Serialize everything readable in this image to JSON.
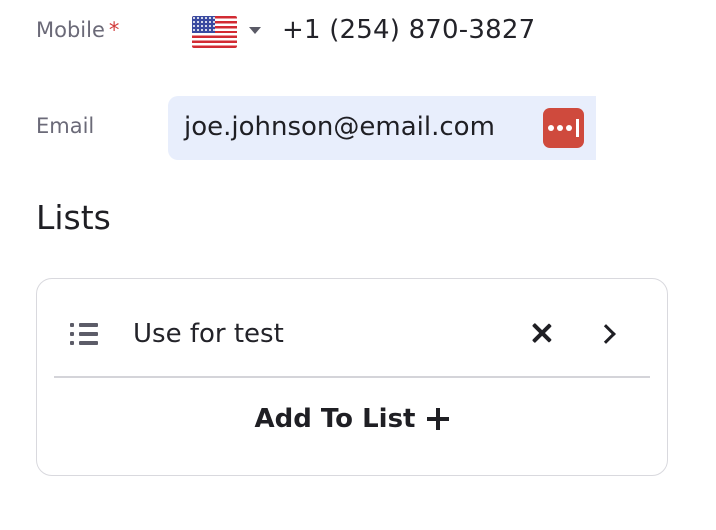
{
  "mobile": {
    "label": "Mobile",
    "required_mark": "*",
    "country_flag": "us-flag-icon",
    "value": "+1 (254) 870-3827"
  },
  "email": {
    "label": "Email",
    "value": "joe.johnson@email.com",
    "autofill_icon": "password-manager-icon"
  },
  "lists": {
    "title": "Lists",
    "items": [
      {
        "label": "Use for test"
      }
    ],
    "add_label": "Add To List"
  },
  "colors": {
    "label": "#6b6a78",
    "required": "#d23b3b",
    "email_bg": "#e8eefc",
    "pw_icon": "#cf4a3d",
    "text": "#1f1f24"
  }
}
